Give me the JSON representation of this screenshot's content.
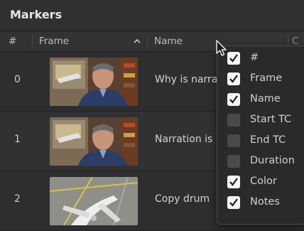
{
  "panel": {
    "title": "Markers"
  },
  "columns": {
    "num": "#",
    "frame": "Frame",
    "name": "Name",
    "next": "C"
  },
  "rows": [
    {
      "num": "0",
      "name": "Why is narra"
    },
    {
      "num": "1",
      "name": "Narration is"
    },
    {
      "num": "2",
      "name": "Copy drum"
    }
  ],
  "column_menu": {
    "items": [
      {
        "label": "#",
        "checked": true
      },
      {
        "label": "Frame",
        "checked": true
      },
      {
        "label": "Name",
        "checked": true
      },
      {
        "label": "Start TC",
        "checked": false
      },
      {
        "label": "End TC",
        "checked": false
      },
      {
        "label": "Duration",
        "checked": false
      },
      {
        "label": "Color",
        "checked": true
      },
      {
        "label": "Notes",
        "checked": true
      }
    ]
  },
  "icons": {
    "sort": "chevron-up-icon",
    "cursor": "mouse-pointer-icon",
    "check": "checkmark-icon"
  }
}
